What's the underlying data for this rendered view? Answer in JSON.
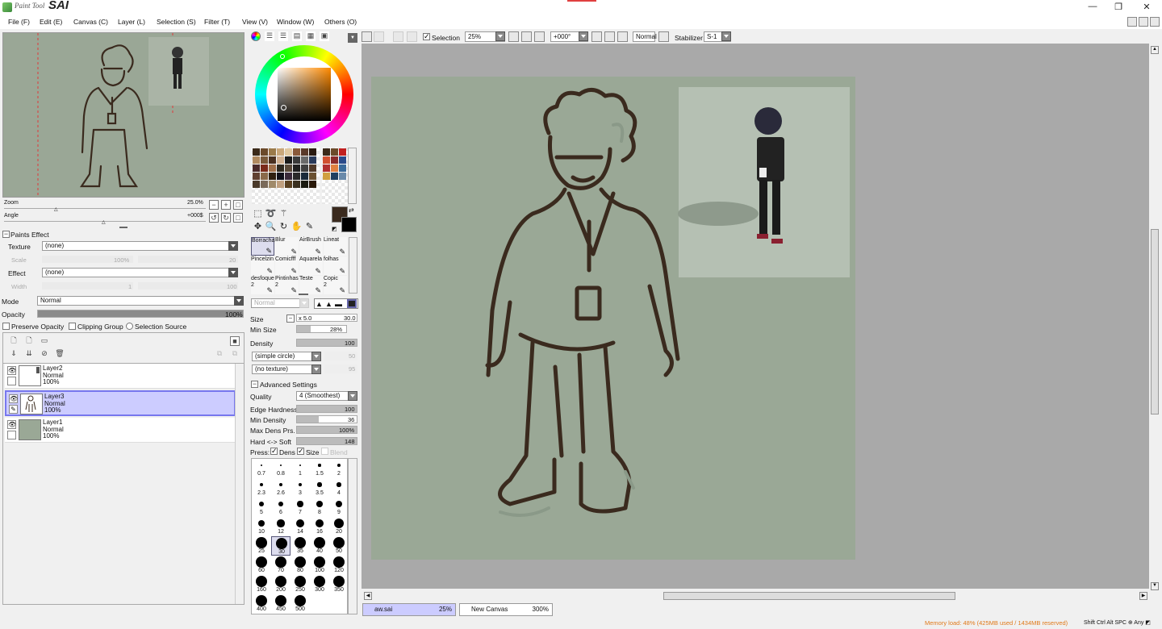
{
  "app": {
    "logo_prefix": "Paint Tool",
    "logo_name": "SAI"
  },
  "window_controls": {
    "minimize": "—",
    "restore": "❐",
    "close": "✕"
  },
  "menu": [
    "File (F)",
    "Edit (E)",
    "Canvas (C)",
    "Layer (L)",
    "Selection (S)",
    "Filter (T)",
    "View (V)",
    "Window (W)",
    "Others (O)"
  ],
  "navigator": {
    "zoom_label": "Zoom",
    "zoom_value": "25.0%",
    "angle_label": "Angle",
    "angle_value": "+000$"
  },
  "paints_effect": {
    "title": "Paints Effect",
    "texture_label": "Texture",
    "texture_value": "(none)",
    "scale_label": "Scale",
    "scale_value": "100%",
    "scale_right": "20",
    "effect_label": "Effect",
    "effect_value": "(none)",
    "width_label": "Width",
    "width_value": "1",
    "width_right": "100"
  },
  "layer_props": {
    "mode_label": "Mode",
    "mode_value": "Normal",
    "opacity_label": "Opacity",
    "opacity_value": "100%",
    "opacity_level": 1.0,
    "preserve_opacity": "Preserve Opacity",
    "clipping_group": "Clipping Group",
    "selection_source": "Selection Source"
  },
  "layers": [
    {
      "name": "Layer2",
      "mode": "Normal",
      "opacity": "100%",
      "selected": false
    },
    {
      "name": "Layer3",
      "mode": "Normal",
      "opacity": "100%",
      "selected": true
    },
    {
      "name": "Layer1",
      "mode": "Normal",
      "opacity": "100%",
      "selected": false
    }
  ],
  "palette_colors": [
    "#3b2a1a",
    "#6b4a2a",
    "#9b7a4a",
    "#c9a77a",
    "#e0c8a0",
    "#8a5a3a",
    "#5a3a2a",
    "#2a1a10",
    "#b08a60",
    "#7a5a3a",
    "#4a3020",
    "#d0b090",
    "#1a1a1a",
    "#3a3a3a",
    "#6a6a6a",
    "#2a3a5a",
    "#4a2a2a",
    "#7a2a1a",
    "#a0704a",
    "#302a20",
    "#5a4a3a",
    "#202020",
    "#404040",
    "#503a2a",
    "#604030",
    "#8a6a4a",
    "#302010",
    "#10101a",
    "#3a2a3a",
    "#2a2a2a",
    "#1a2a3a",
    "#6a5030",
    "#4a3a2a",
    "#7a6a5a",
    "#a08a6a",
    "#c0a080",
    "#5a4020",
    "#3a3020",
    "#1a1a10",
    "#2a1a0a"
  ],
  "palette_colors_right": [
    "#3b2a1a",
    "#6b4a2a",
    "#c02020",
    "#d05030",
    "#8a2a2a",
    "#2a4a8a",
    "#b03030",
    "#e08040",
    "#3a6a9a",
    "#d0a040",
    "#204060",
    "#6a8aaa"
  ],
  "brushes": [
    {
      "name": "Borracha",
      "sub": ""
    },
    {
      "name": "Blur",
      "sub": ""
    },
    {
      "name": "AirBrush",
      "sub": ""
    },
    {
      "name": "Lineat",
      "sub": ""
    },
    {
      "name": "Pincelzin",
      "sub": ""
    },
    {
      "name": "Comicfff",
      "sub": ""
    },
    {
      "name": "Aquarela",
      "sub": ""
    },
    {
      "name": "folhas",
      "sub": ""
    },
    {
      "name": "desfoque",
      "sub": "2"
    },
    {
      "name": "Pintinhas",
      "sub": "2"
    },
    {
      "name": "Teste",
      "sub": ""
    },
    {
      "name": "Copic",
      "sub": "2"
    }
  ],
  "brush_settings": {
    "blend_mode": "Normal",
    "size_label": "Size",
    "size_mult": "x 5.0",
    "size_value": "30.0",
    "min_size_label": "Min Size",
    "min_size_value": "28%",
    "min_size_level": 0.28,
    "density_label": "Density",
    "density_value": "100",
    "density_level": 1.0,
    "shape": "(simple circle)",
    "shape_right": "50",
    "texture": "(no texture)",
    "texture_right": "95",
    "advanced_title": "Advanced Settings",
    "quality_label": "Quality",
    "quality_value": "4 (Smoothest)",
    "edge_hardness_label": "Edge Hardness",
    "edge_hardness_value": "100",
    "edge_hardness_level": 1.0,
    "min_density_label": "Min Density",
    "min_density_value": "36",
    "min_density_level": 0.36,
    "max_dens_label": "Max Dens Prs.",
    "max_dens_value": "100%",
    "max_dens_level": 1.0,
    "hard_soft_label": "Hard <-> Soft",
    "hard_soft_value": "148",
    "hard_soft_level": 1.0,
    "press_label": "Press:",
    "press_dens": "Dens",
    "press_size": "Size",
    "press_blend": "Blend"
  },
  "brush_sizes": [
    "0.7",
    "0.8",
    "1",
    "1.5",
    "2",
    "2.3",
    "2.6",
    "3",
    "3.5",
    "4",
    "5",
    "6",
    "7",
    "8",
    "9",
    "10",
    "12",
    "14",
    "16",
    "20",
    "25",
    "30",
    "35",
    "40",
    "50",
    "60",
    "70",
    "80",
    "100",
    "120",
    "160",
    "200",
    "250",
    "300",
    "350",
    "400",
    "450",
    "500"
  ],
  "selected_brush_size": "30",
  "toolbar": {
    "selection_label": "Selection",
    "zoom": "25%",
    "angle": "+000°",
    "blend": "Normal",
    "stabilizer_label": "Stabilizer",
    "stabilizer_value": "S-1"
  },
  "tabs": [
    {
      "name": "aw.sai",
      "zoom": "25%",
      "active": true
    },
    {
      "name": "New Canvas",
      "zoom": "300%",
      "active": false
    }
  ],
  "status": {
    "memory": "Memory load: 48% (425MB used / 1434MB reserved)",
    "keys": "Shift Ctrl Alt SPC ⊕ Any ◩"
  },
  "colors": {
    "canvas_bg": "#9aa896",
    "line": "#3a2a1e",
    "primary": "#3a2a1e",
    "secondary": "#000000",
    "selected_layer": "#ccccff",
    "memory_text": "#e07a1a"
  }
}
